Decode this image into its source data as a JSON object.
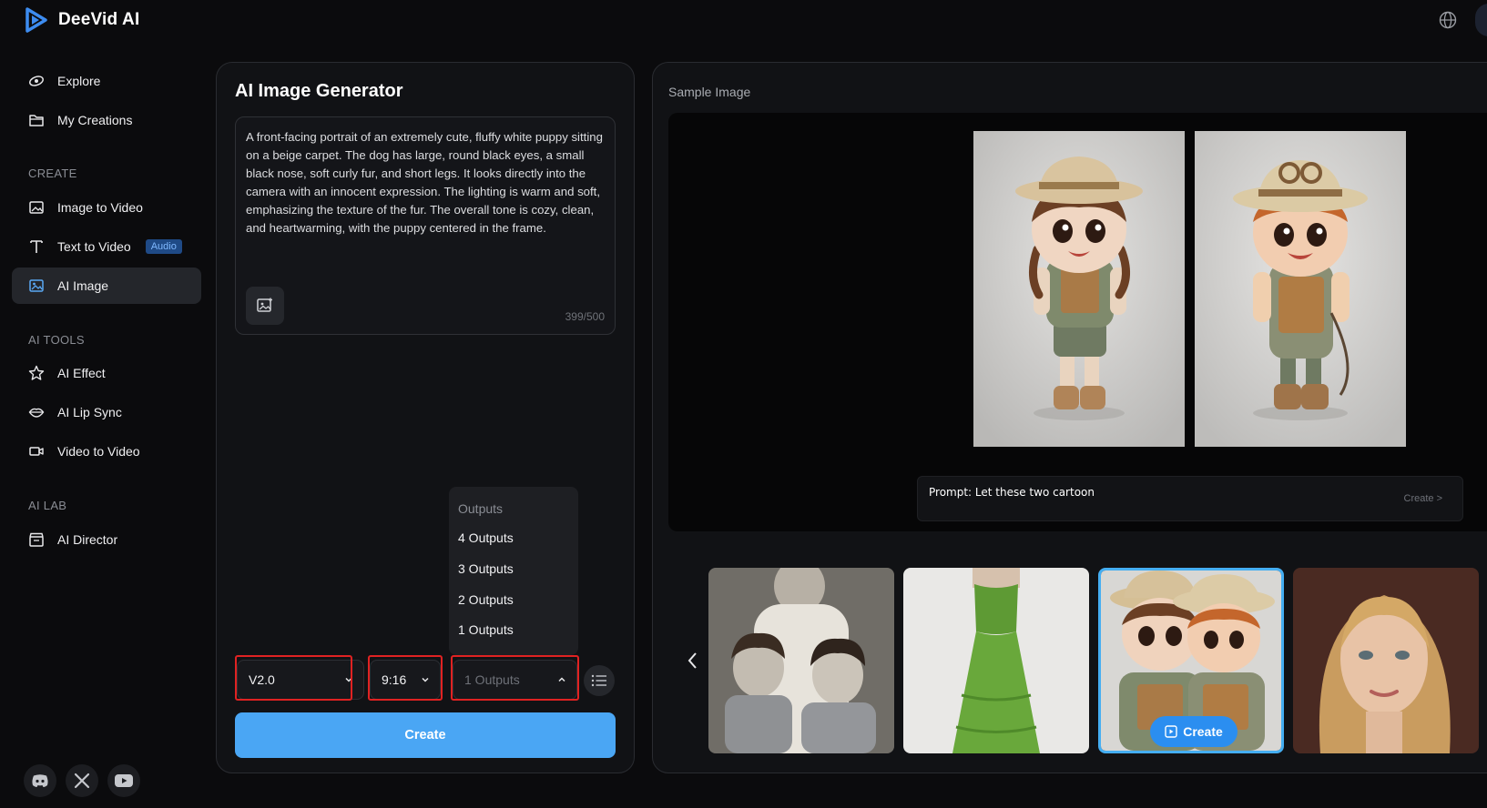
{
  "app": {
    "name": "DeeVid AI"
  },
  "sidebar": {
    "items": [
      {
        "label": "Explore"
      },
      {
        "label": "My Creations"
      }
    ],
    "sections": {
      "create": {
        "title": "CREATE",
        "items": [
          {
            "label": "Image to Video"
          },
          {
            "label": "Text to Video",
            "badge": "Audio"
          },
          {
            "label": "AI Image",
            "active": true
          }
        ]
      },
      "ai_tools": {
        "title": "AI TOOLS",
        "items": [
          {
            "label": "AI Effect"
          },
          {
            "label": "AI Lip Sync"
          },
          {
            "label": "Video to Video"
          }
        ]
      },
      "ai_lab": {
        "title": "AI LAB",
        "items": [
          {
            "label": "AI Director"
          }
        ]
      }
    },
    "socials": [
      "discord-icon",
      "x-icon",
      "youtube-icon"
    ]
  },
  "generator": {
    "title": "AI Image Generator",
    "prompt": "A front-facing portrait of an extremely cute, fluffy white puppy sitting on a beige carpet. The dog has large, round black eyes, a small black nose, soft curly fur, and short legs. It looks directly into the camera with an innocent expression. The lighting is warm and soft, emphasizing the texture of the fur. The overall tone is cozy, clean, and heartwarming, with the puppy centered in the frame.",
    "char_count": "399/500",
    "model": "V2.0",
    "ratio": "9:16",
    "outputs": "1 Outputs",
    "outputs_menu": {
      "header": "Outputs",
      "options": [
        "4 Outputs",
        "3 Outputs",
        "2 Outputs",
        "1 Outputs"
      ]
    },
    "create_label": "Create"
  },
  "sample": {
    "label": "Sample Image",
    "prompt_text": "Prompt:  Let these two cartoon",
    "prompt_link": "Create >",
    "thumb_create_label": "Create"
  },
  "colors": {
    "accent": "#4aa6f4",
    "highlight_outline": "#e02222",
    "badge": "#1f4a86"
  }
}
